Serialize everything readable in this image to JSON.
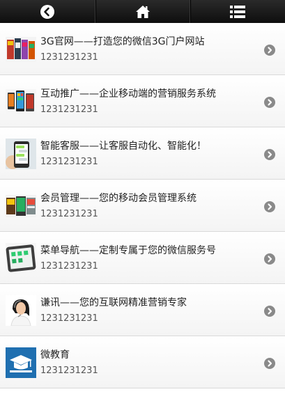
{
  "topbar": {
    "buttons": [
      {
        "icon": "back-circle-icon"
      },
      {
        "icon": "home-icon"
      },
      {
        "icon": "menu-list-icon"
      }
    ]
  },
  "colors": {
    "topbar_bg": "#111111",
    "arrow_bg": "#8a8a8a",
    "education_blue": "#1f6fb0"
  },
  "items": [
    {
      "title": "3G官网——打造您的微信3G门户网站",
      "subtitle": "1231231231",
      "thumb": "3g-website-thumbnail"
    },
    {
      "title": "互动推广——企业移动端的营销服务系统",
      "subtitle": "1231231231",
      "thumb": "interactive-promotion-thumbnail"
    },
    {
      "title": "智能客服——让客服自动化、智能化！",
      "subtitle": "1231231231",
      "thumb": "smart-service-thumbnail"
    },
    {
      "title": "会员管理——您的移动会员管理系统",
      "subtitle": "1231231231",
      "thumb": "member-management-thumbnail"
    },
    {
      "title": "菜单导航——定制专属于您的微信服务号",
      "subtitle": "1231231231",
      "thumb": "menu-navigation-thumbnail"
    },
    {
      "title": "谦讯——您的互联网精准营销专家",
      "subtitle": "1231231231",
      "thumb": "customer-service-woman-thumbnail"
    },
    {
      "title": "微教育",
      "subtitle": "1231231231",
      "thumb": "education-cap-thumbnail"
    }
  ]
}
